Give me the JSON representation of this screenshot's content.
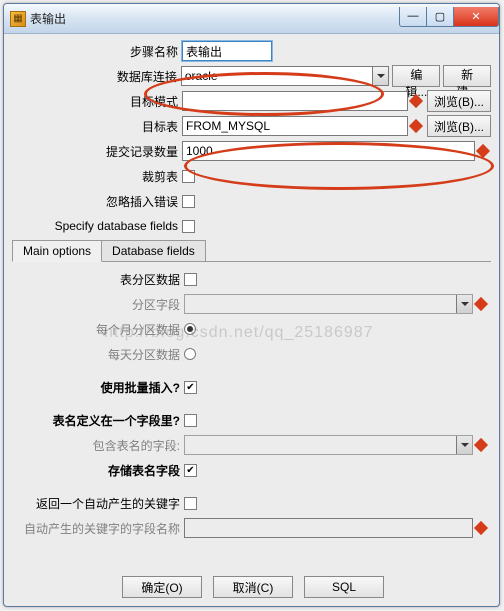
{
  "window": {
    "title": "表输出"
  },
  "labels": {
    "stepName": "步骤名称",
    "dbConnection": "数据库连接",
    "targetSchema": "目标模式",
    "targetTable": "目标表",
    "commitSize": "提交记录数量",
    "truncate": "裁剪表",
    "ignoreInsertErrors": "忽略插入错误",
    "specifyFields": "Specify database fields"
  },
  "fields": {
    "stepName": "表输出",
    "dbConnection": "oracle",
    "targetSchema": "",
    "targetTable": "FROM_MYSQL",
    "commitSize": "1000"
  },
  "buttons": {
    "edit": "编辑...",
    "new": "新建...",
    "browse": "浏览(B)...",
    "ok": "确定(O)",
    "cancel": "取消(C)",
    "sql": "SQL"
  },
  "tabs": {
    "main": "Main options",
    "dbfields": "Database fields"
  },
  "main": {
    "partitionData": "表分区数据",
    "partitionField": "分区字段",
    "partitionMonthly": "每个月分区数据",
    "partitionDaily": "每天分区数据",
    "useBatch": "使用批量插入?",
    "tableNameInField": "表名定义在一个字段里?",
    "tableNameField": "包含表名的字段:",
    "storeTableName": "存储表名字段",
    "returnAutoKey": "返回一个自动产生的关键字",
    "autoKeyField": "自动产生的关键字的字段名称"
  },
  "checks": {
    "truncate": false,
    "ignore": false,
    "specify": false,
    "partition": false,
    "useBatch": true,
    "tableNameInField": false,
    "storeTableName": true,
    "returnAutoKey": false
  },
  "watermark": "http://blog.csdn.net/qq_25186987"
}
